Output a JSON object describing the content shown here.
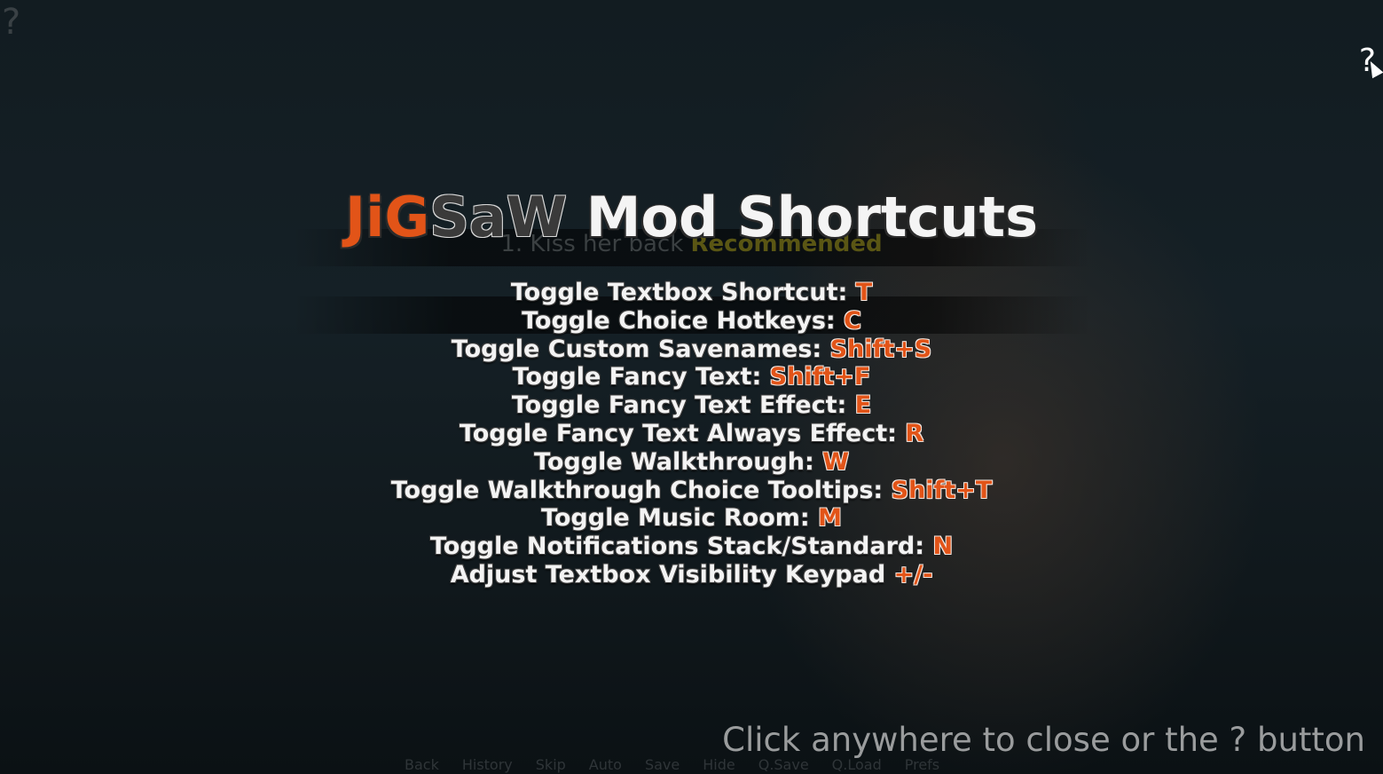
{
  "background_choice": {
    "text": "1. Kiss her back",
    "tag": "Recommended"
  },
  "help_buttons": {
    "top_left": "?",
    "top_right": "?"
  },
  "title": {
    "ji": "JiG",
    "saw": "SaW",
    "rest": " Mod Shortcuts"
  },
  "shortcuts": [
    {
      "label": "Toggle Textbox Shortcut: ",
      "key": "T"
    },
    {
      "label": "Toggle Choice Hotkeys: ",
      "key": "C"
    },
    {
      "label": "Toggle Custom Savenames: ",
      "key": "Shift+S"
    },
    {
      "label": "Toggle Fancy Text: ",
      "key": "Shift+F"
    },
    {
      "label": "Toggle Fancy Text Effect: ",
      "key": "E"
    },
    {
      "label": "Toggle Fancy Text Always Effect: ",
      "key": "R"
    },
    {
      "label": "Toggle Walkthrough: ",
      "key": "W"
    },
    {
      "label": "Toggle Walkthrough Choice Tooltips: ",
      "key": "Shift+T"
    },
    {
      "label": "Toggle Music Room: ",
      "key": "M"
    },
    {
      "label": "Toggle Notifications Stack/Standard: ",
      "key": "N"
    },
    {
      "label": "Adjust Textbox Visibility Keypad ",
      "key": "+/-"
    }
  ],
  "close_hint": "Click anywhere to close or the ? button",
  "quick_menu": [
    "Back",
    "History",
    "Skip",
    "Auto",
    "Save",
    "Hide",
    "Q.Save",
    "Q.Load",
    "Prefs"
  ],
  "colors": {
    "accent": "#e25418",
    "text": "#f3f3f3"
  }
}
